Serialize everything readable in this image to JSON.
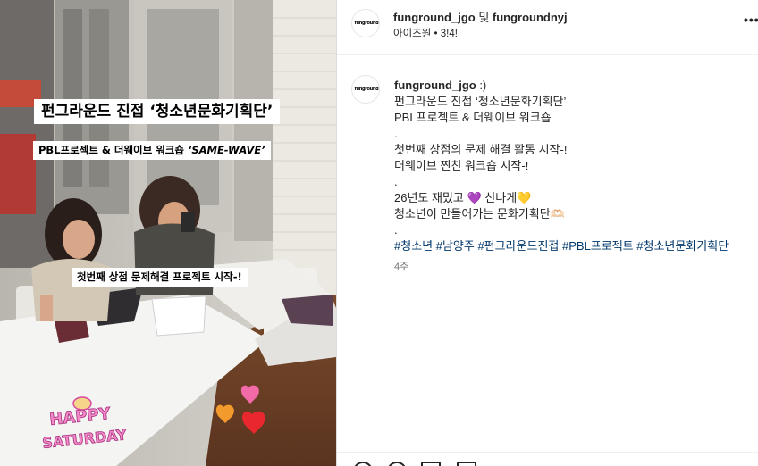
{
  "media": {
    "title_overlay": "펀그라운드 진접 ‘청소년문화기획단’",
    "subtitle_overlay_prefix": "PBL프로젝트 &  더웨이브 워크숍 ",
    "subtitle_overlay_tag": "‘SAME-WAVE’",
    "caption_overlay": "첫번째 상점 문제해결 프로젝트 시작-!",
    "sticker_text_1": "HAPPY",
    "sticker_text_2": "SATURDAY"
  },
  "header": {
    "avatar_logo_text": "funground",
    "user_primary": "funground_jgo",
    "and_label": " 및 ",
    "user_secondary": "fungroundnyj",
    "subtitle": "아이즈원 • 3!4!",
    "more_label": "•••"
  },
  "post": {
    "avatar_logo_text": "funground",
    "username": "funground_jgo",
    "username_suffix": " :)",
    "lines": [
      "펀그라운드 진접 ‘청소년문화기획단’",
      "PBL프로젝트 & 더웨이브 워크숍",
      ".",
      "첫번째 상점의 문제 해결 활동 시작-!",
      "더웨이브 찐친 워크숍 시작-!",
      ".",
      "26년도 재밌고 💜 신나게💛",
      "청소년이 만들어가는 문화기획단🫶🏻",
      "."
    ],
    "hashtags": "#청소년 #남양주 #펀그라운드진접 #PBL프로젝트 #청소년문화기획단",
    "time": "4주"
  },
  "colors": {
    "hashtag": "#00376b",
    "text": "#262626",
    "muted": "#737373",
    "border": "#dbdbdb"
  },
  "icons": [
    "more-options-icon",
    "like-icon",
    "comment-icon",
    "share-icon",
    "save-icon"
  ]
}
